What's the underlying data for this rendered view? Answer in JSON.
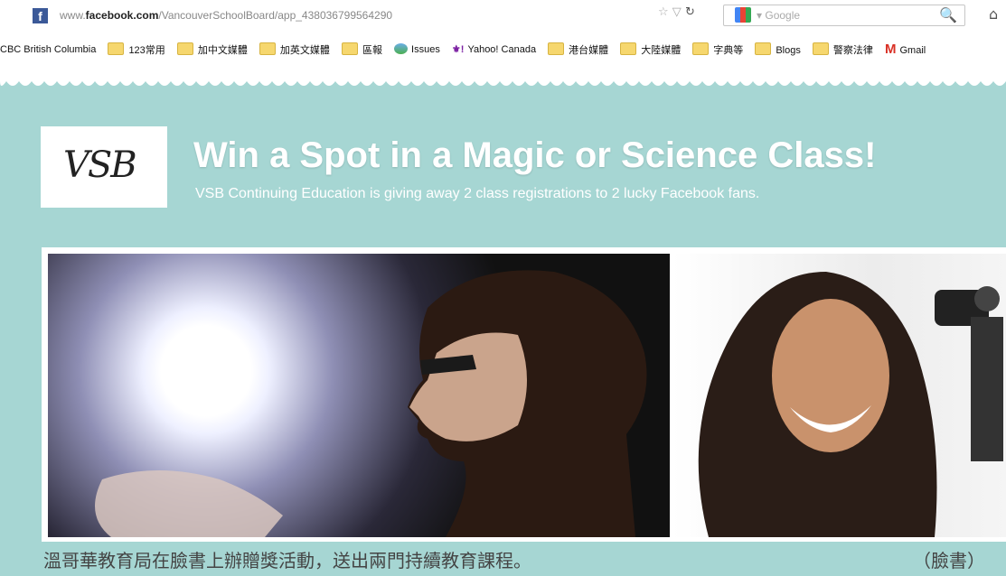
{
  "browser": {
    "url_prefix": "www.",
    "url_domain": "facebook.com",
    "url_path": "/VancouverSchoolBoard/app_438036799564290",
    "search_placeholder": "Google"
  },
  "bookmarks": [
    {
      "label": "CBC British Columbia",
      "icon": "globe-icon"
    },
    {
      "label": "123常用",
      "icon": "folder-icon"
    },
    {
      "label": "加中文媒體",
      "icon": "folder-icon"
    },
    {
      "label": "加英文媒體",
      "icon": "folder-icon"
    },
    {
      "label": "區報",
      "icon": "folder-icon"
    },
    {
      "label": "Issues",
      "icon": "globe-icon"
    },
    {
      "label": "Yahoo! Canada",
      "icon": "yahoo-icon"
    },
    {
      "label": "港台媒體",
      "icon": "folder-icon"
    },
    {
      "label": "大陸媒體",
      "icon": "folder-icon"
    },
    {
      "label": "字典等",
      "icon": "folder-icon"
    },
    {
      "label": "Blogs",
      "icon": "folder-icon"
    },
    {
      "label": "警察法律",
      "icon": "folder-icon"
    },
    {
      "label": "Gmail",
      "icon": "gmail-icon"
    }
  ],
  "page": {
    "logo_text": "VSB",
    "title": "Win a Spot in a Magic or Science Class!",
    "subtitle": "VSB Continuing Education is giving away 2 class registrations to 2 lucky Facebook fans."
  },
  "caption": {
    "text": "溫哥華教育局在臉書上辦贈獎活動，送出兩門持續教育課程。",
    "credit": "（臉書）"
  }
}
